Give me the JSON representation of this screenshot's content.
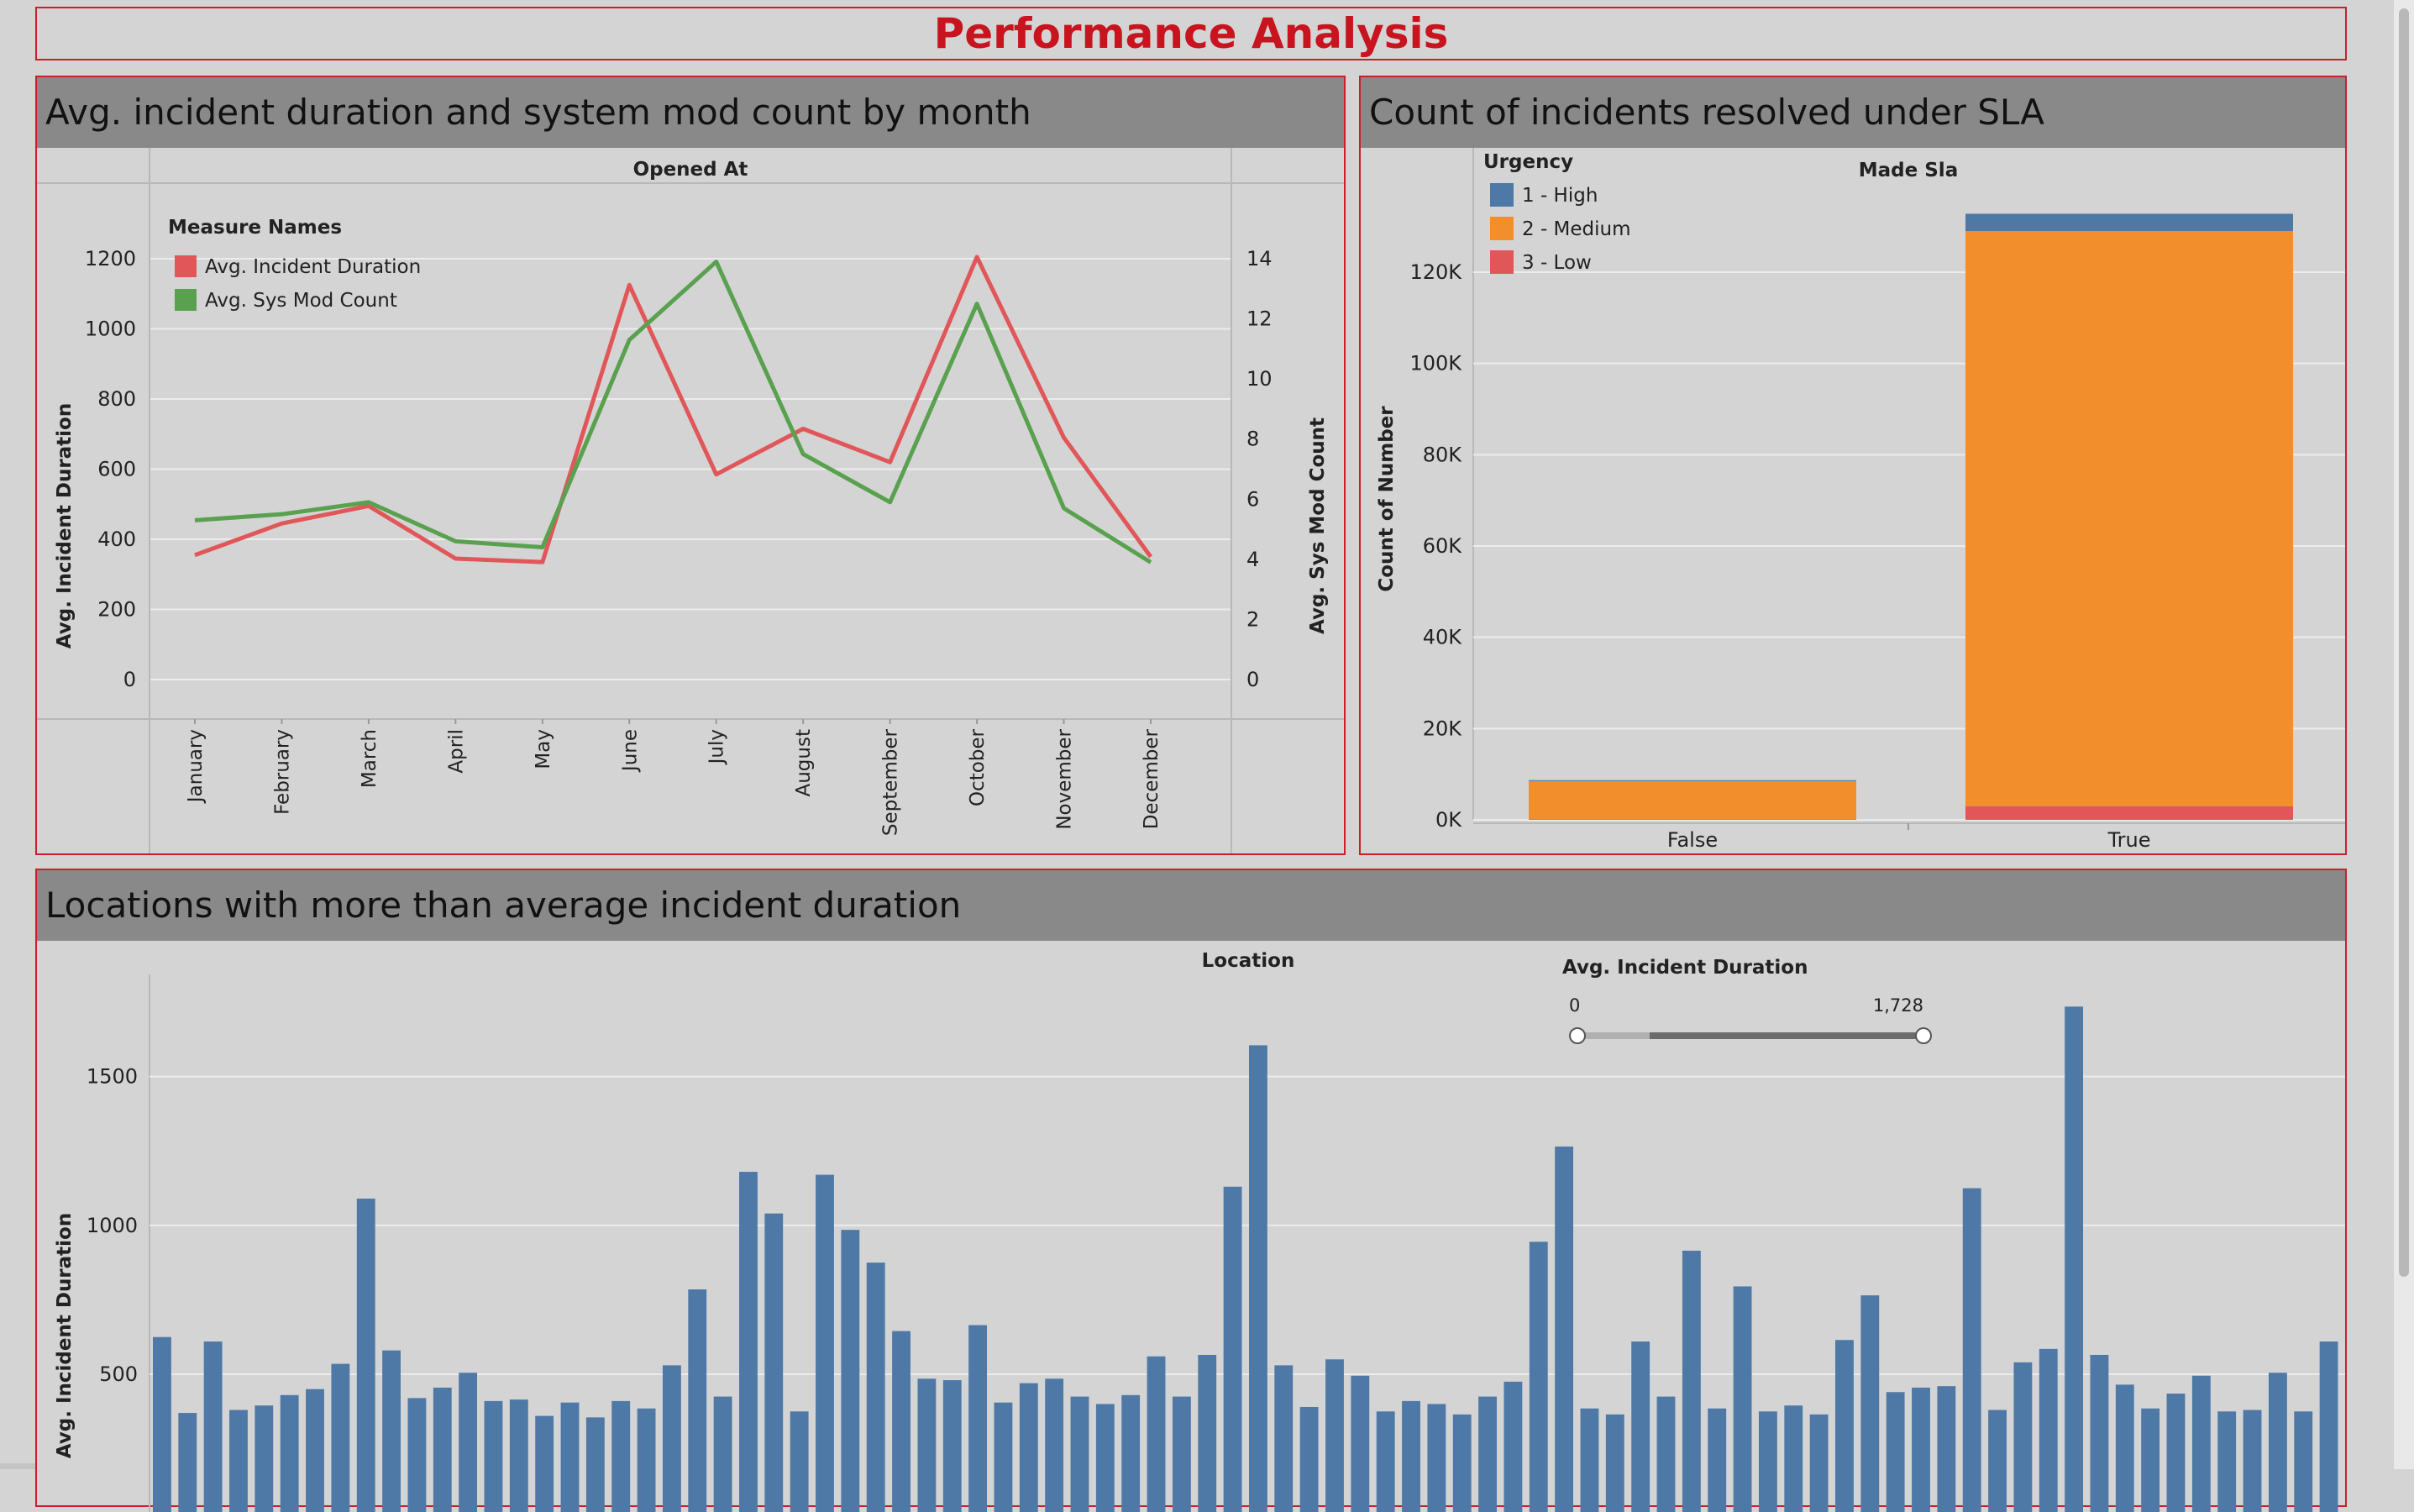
{
  "dashboard": {
    "title": "Performance Analysis"
  },
  "panels": {
    "monthly": {
      "title": "Avg. incident duration and system mod count by month"
    },
    "sla": {
      "title": "Count of incidents resolved under SLA"
    },
    "locations": {
      "title": "Locations with more than average incident duration"
    }
  },
  "filter": {
    "title": "Avg. Incident Duration",
    "min_label": "0",
    "max_label": "1,728",
    "min": 0,
    "max": 1728
  },
  "chart_data": [
    {
      "type": "line",
      "header": "Opened At",
      "legend_title": "Measure Names",
      "legend_position": "top-left",
      "categories": [
        "January",
        "February",
        "March",
        "April",
        "May",
        "June",
        "July",
        "August",
        "September",
        "October",
        "November",
        "December"
      ],
      "series": [
        {
          "name": "Avg. Incident Duration",
          "axis": "left",
          "color": "#e15759",
          "values": [
            355,
            445,
            495,
            345,
            335,
            1125,
            585,
            715,
            620,
            1205,
            690,
            350
          ]
        },
        {
          "name": "Avg. Sys Mod Count",
          "axis": "right",
          "color": "#59a14f",
          "values": [
            5.3,
            5.5,
            5.9,
            4.6,
            4.4,
            11.3,
            13.9,
            7.5,
            5.9,
            12.5,
            5.7,
            3.9
          ]
        }
      ],
      "ylabel": "Avg. Incident Duration",
      "ylabel_right": "Avg. Sys Mod Count",
      "ylim": [
        0,
        1270
      ],
      "ylim_right": [
        0,
        14.7
      ],
      "yticks": [
        "0",
        "200",
        "400",
        "600",
        "800",
        "1000",
        "1200"
      ],
      "yticks_right": [
        "0",
        "2",
        "4",
        "6",
        "8",
        "10",
        "12",
        "14"
      ],
      "grid": true
    },
    {
      "type": "bar",
      "stacked": true,
      "header": "Made Sla",
      "legend_title": "Urgency",
      "legend_position": "top-left",
      "categories": [
        "False",
        "True"
      ],
      "series": [
        {
          "name": "3 - Low",
          "color": "#e15759",
          "values": [
            100,
            3000
          ]
        },
        {
          "name": "2 - Medium",
          "color": "#f28e2b",
          "values": [
            8400,
            126000
          ]
        },
        {
          "name": "1 - High",
          "color": "#4e79a7",
          "values": [
            200,
            3800
          ]
        }
      ],
      "ylabel": "Count of Number",
      "ylim": [
        0,
        135000
      ],
      "yticks": [
        "0K",
        "20K",
        "40K",
        "60K",
        "80K",
        "100K",
        "120K"
      ],
      "grid": true
    },
    {
      "type": "bar",
      "header": "Location",
      "color": "#4e79a7",
      "values": [
        625,
        370,
        610,
        380,
        395,
        430,
        450,
        535,
        1090,
        580,
        420,
        455,
        505,
        410,
        415,
        360,
        405,
        355,
        410,
        385,
        530,
        785,
        425,
        1180,
        1040,
        375,
        1170,
        985,
        875,
        645,
        485,
        480,
        665,
        405,
        470,
        485,
        425,
        400,
        430,
        560,
        425,
        565,
        1130,
        1605,
        530,
        390,
        550,
        495,
        375,
        410,
        400,
        365,
        425,
        475,
        945,
        1265,
        385,
        365,
        610,
        425,
        915,
        385,
        795,
        375,
        395,
        365,
        615,
        765,
        440,
        455,
        460,
        1125,
        380,
        540,
        585,
        1735,
        565,
        465,
        385,
        435,
        495,
        375,
        380,
        505,
        375,
        610
      ],
      "ylabel": "Avg. Incident Duration",
      "ylim": [
        290,
        1780
      ],
      "yticks": [
        "500",
        "1000",
        "1500"
      ],
      "grid": true
    }
  ]
}
